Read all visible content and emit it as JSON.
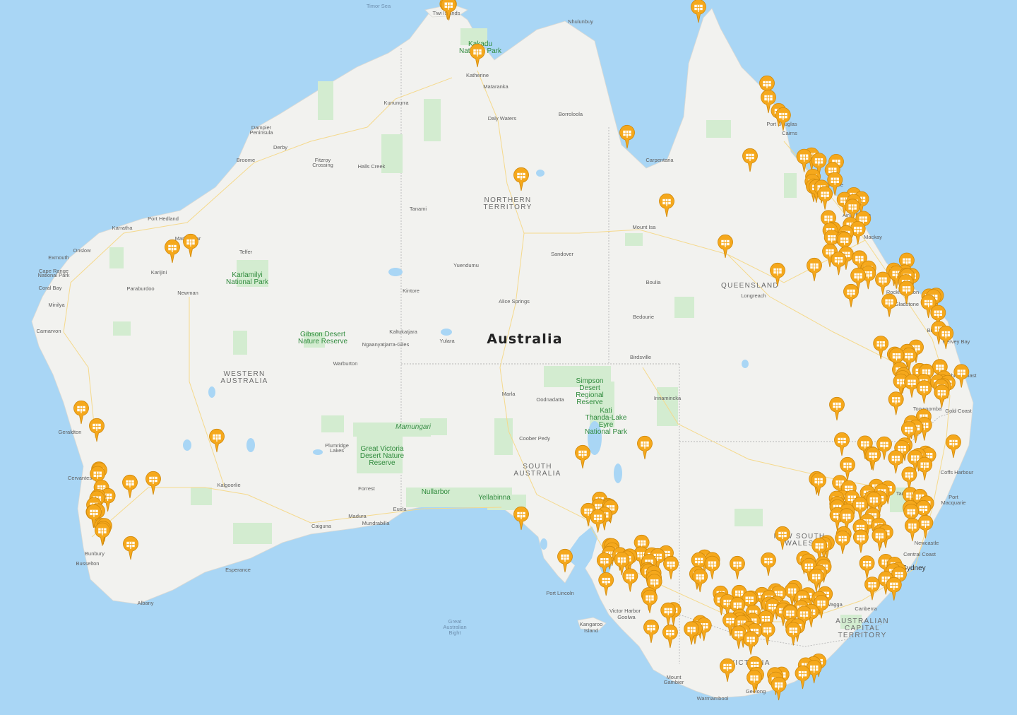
{
  "map": {
    "country": "Australia",
    "states": [
      "NORTHERN",
      "TERRITORY",
      "WESTERN",
      "AUSTRALIA",
      "QUEENSLAND",
      "SOUTH",
      "AUSTRALIA",
      "NEW SOUTH",
      "WALES",
      "VICTORIA",
      "AUSTRALIAN",
      "CAPITAL",
      "TERRITORY"
    ],
    "seas": [
      "Timor Sea",
      "Great",
      "Australian",
      "Bight"
    ],
    "parks": [
      "Kakadu",
      "National Park",
      "Karlamilyi",
      "National Park",
      "Gibson Desert",
      "Nature Reserve",
      "Great Victoria",
      "Desert Nature",
      "Reserve",
      "Simpson",
      "Desert",
      "Regional",
      "Reserve",
      "Kati",
      "Thanda-Lake",
      "Eyre",
      "National Park",
      "Nullarbor",
      "Yellabinna"
    ],
    "remarks": [
      "Mamungari"
    ],
    "places": [
      "Tiwi Islands",
      "Katherine",
      "Mataranka",
      "Nhulunbuy",
      "Kununurra",
      "Daly Waters",
      "Borroloola",
      "Dampier",
      "Peninsula",
      "Derby",
      "Broome",
      "Fitzroy",
      "Crossing",
      "Halls Creek",
      "Carpentaria",
      "Tanami",
      "Port Hedland",
      "Karratha",
      "Marble Bar",
      "Onslow",
      "Exmouth",
      "Cape Range",
      "National Park",
      "Coral Bay",
      "Telfer",
      "Karijini",
      "Paraburdoo",
      "Newman",
      "Minilya",
      "Carnarvon",
      "Yuendumu",
      "Sandover",
      "Mount Isa",
      "Kintore",
      "Alice Springs",
      "Boulia",
      "Longreach",
      "Bedourie",
      "Kaltukatjara",
      "Ngaanyatjarra-Giles",
      "Yulara",
      "Warburton",
      "Birdsville",
      "Innamincka",
      "Marla",
      "Oodnadatta",
      "Geraldton",
      "Plumridge",
      "Lakes",
      "Coober Pedy",
      "Cervantes",
      "Kalgoorlie",
      "Forrest",
      "Madura",
      "Eucla",
      "Mundrabilla",
      "Caiguna",
      "Bunbury",
      "Busselton",
      "Esperance",
      "Albany",
      "Port Lincoln",
      "Kangaroo",
      "Island",
      "Victor Harbor",
      "Goolwa",
      "Mount",
      "Gambier",
      "Warrnambool",
      "Geelong",
      "Wagga",
      "Canberra",
      "Central Coast",
      "Coffs Harbour",
      "Port",
      "Macquarie",
      "Tamworth",
      "Newcastle",
      "Toowoomba",
      "Gold Coast",
      "Sunshine Coast",
      "Bundaberg",
      "Hervey Bay",
      "Gladstone",
      "Rockhampton",
      "Mackay",
      "Airlie Beach",
      "Townsville",
      "Cairns",
      "Port Douglas"
    ],
    "cities": [
      "Sydney"
    ]
  },
  "markers": {
    "icon": "solar-panel-icon",
    "color": "#f5a81c",
    "count": 238
  }
}
